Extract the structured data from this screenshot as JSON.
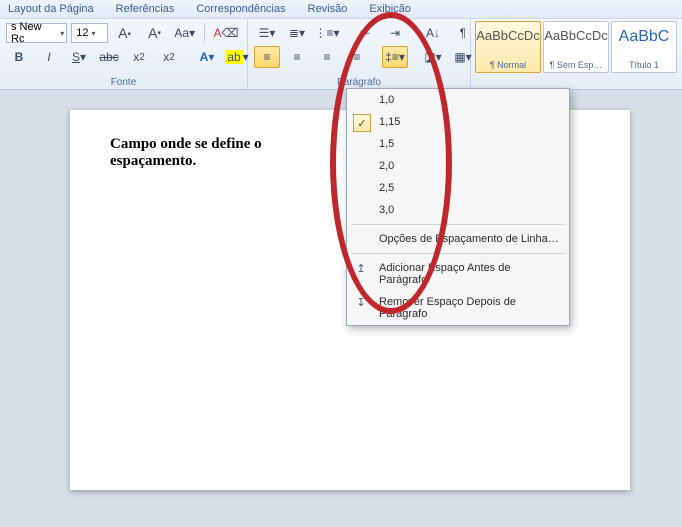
{
  "tabs": {
    "layout": "Layout da Página",
    "references": "Referências",
    "mailings": "Correspondências",
    "review": "Revisão",
    "view": "Exibição"
  },
  "font": {
    "name": "s New Rc",
    "size": "12",
    "group_label": "Fonte"
  },
  "paragraph": {
    "group_label": "Parágrafo"
  },
  "styles": {
    "sample": "AaBbCcDc",
    "sample_title": "AaBbC",
    "normal": "¶ Normal",
    "nospacing": "¶ Sem Esp…",
    "heading1": "Título 1"
  },
  "line_spacing_menu": {
    "opts": [
      "1,0",
      "1,15",
      "1,5",
      "2,0",
      "2,5",
      "3,0"
    ],
    "selected_index": 1,
    "options_label": "Opções de Espaçamento de Linha…",
    "add_before": "Adicionar Espaço Antes de Parágrafo",
    "remove_after": "Remover Espaço Depois de Parágrafo"
  },
  "document": {
    "text": "Campo onde se define o espaçamento."
  }
}
